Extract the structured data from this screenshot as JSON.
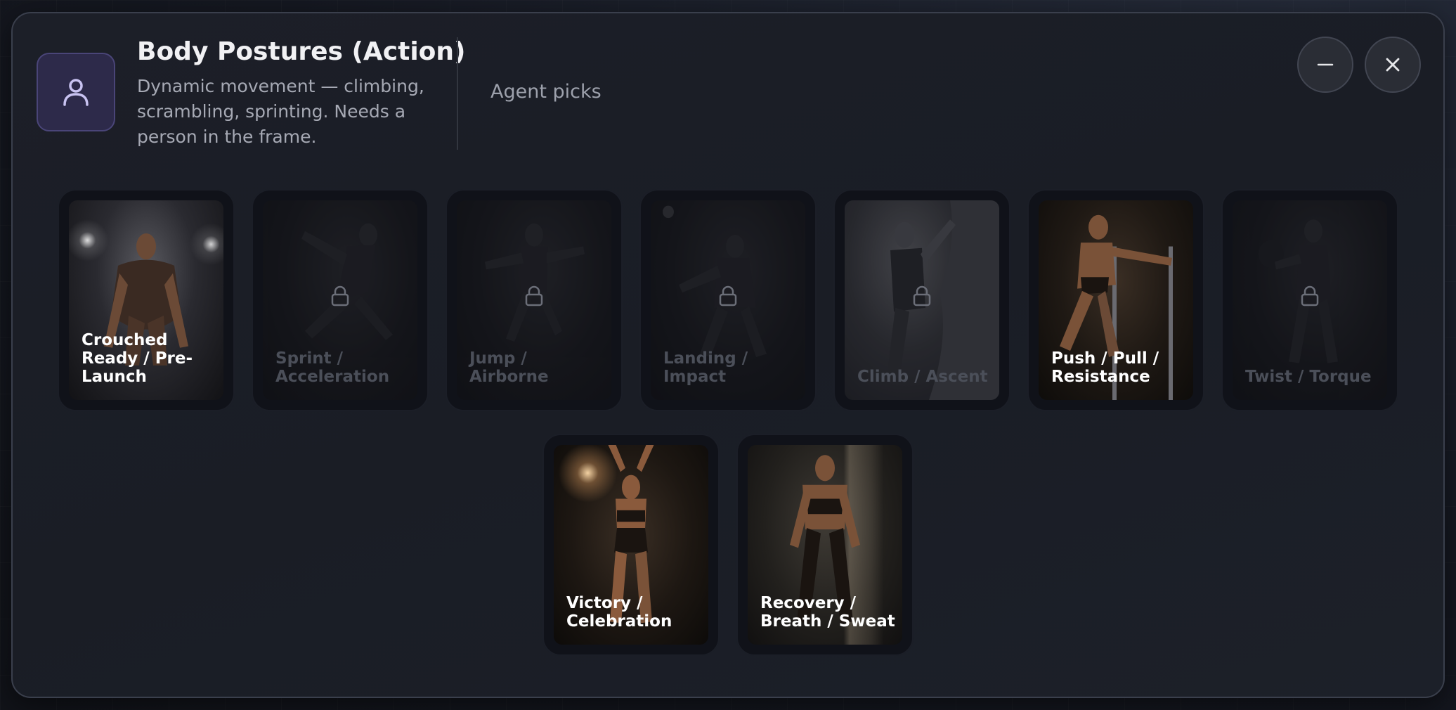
{
  "header": {
    "title": "Body Postures (Action)",
    "subtitle": "Dynamic movement — climbing, scrambling, sprinting. Needs a person in the frame.",
    "agent_picks": "Agent picks"
  },
  "icons": {
    "avatar": "person-icon",
    "minimize": "minus-icon",
    "close": "close-icon",
    "lock": "lock-icon"
  },
  "colors": {
    "accent": "#2d2a4a",
    "accent_icon": "#c9c3f2"
  },
  "cards": [
    {
      "label": "Crouched Ready / Pre-Launch",
      "locked": false
    },
    {
      "label": "Sprint / Acceleration",
      "locked": true
    },
    {
      "label": "Jump / Airborne",
      "locked": true
    },
    {
      "label": "Landing / Impact",
      "locked": true
    },
    {
      "label": "Climb / Ascent",
      "locked": true
    },
    {
      "label": "Push / Pull / Resistance",
      "locked": false
    },
    {
      "label": "Twist / Torque",
      "locked": true
    },
    {
      "label": "Victory / Celebration",
      "locked": false
    },
    {
      "label": "Recovery / Breath / Sweat",
      "locked": false
    }
  ]
}
